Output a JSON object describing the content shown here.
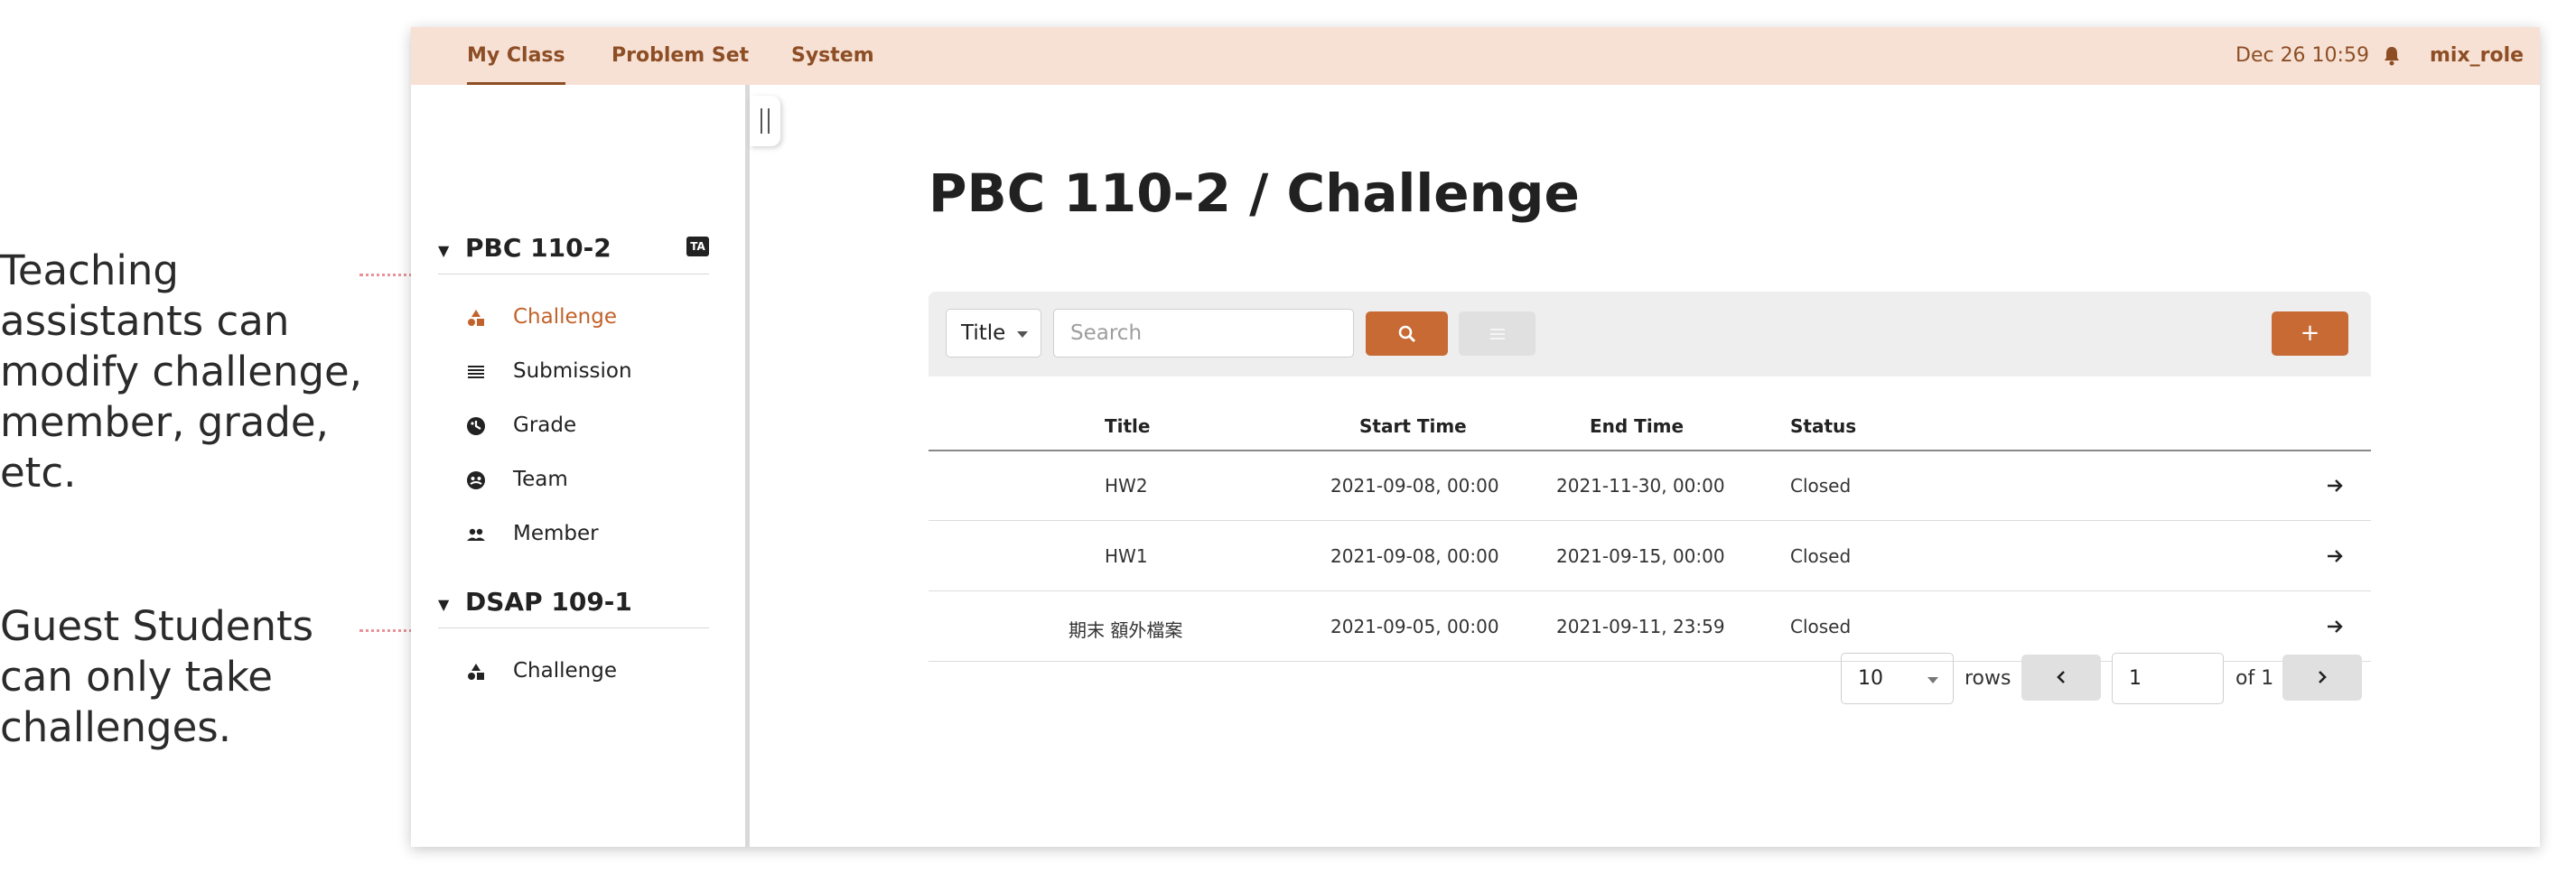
{
  "annotations": [
    {
      "lines": [
        "Teaching",
        "assistants can",
        "modify challenge,",
        "member, grade,",
        "etc."
      ]
    },
    {
      "lines": [
        "Guest Students",
        "can only take",
        "challenges."
      ]
    }
  ],
  "topbar": {
    "nav": [
      {
        "label": "My Class",
        "active": true
      },
      {
        "label": "Problem Set"
      },
      {
        "label": "System"
      }
    ],
    "datetime": "Dec 26 10:59",
    "username": "mix_role",
    "bell_icon": "bell-icon"
  },
  "sidebar": {
    "courses": [
      {
        "name": "PBC 110-2",
        "badge": "TA",
        "items": [
          {
            "label": "Challenge",
            "icon": "shapes-icon",
            "active": true
          },
          {
            "label": "Submission",
            "icon": "list-icon"
          },
          {
            "label": "Grade",
            "icon": "grade-icon"
          },
          {
            "label": "Team",
            "icon": "team-icon"
          },
          {
            "label": "Member",
            "icon": "people-icon"
          }
        ]
      },
      {
        "name": "DSAP 109-1",
        "items": [
          {
            "label": "Challenge",
            "icon": "shapes-icon"
          }
        ]
      }
    ]
  },
  "main": {
    "title": "PBC 110-2 / Challenge",
    "filter": {
      "field": "Title",
      "search_placeholder": "Search",
      "add_label": "+"
    },
    "table": {
      "columns": [
        "Title",
        "Start Time",
        "End Time",
        "Status"
      ],
      "rows": [
        {
          "title": "HW2",
          "start": "2021-09-08, 00:00",
          "end": "2021-11-30, 00:00",
          "status": "Closed"
        },
        {
          "title": "HW1",
          "start": "2021-09-08, 00:00",
          "end": "2021-09-15, 00:00",
          "status": "Closed"
        },
        {
          "title": "期末 額外檔案",
          "start": "2021-09-05, 00:00",
          "end": "2021-09-11, 23:59",
          "status": "Closed"
        }
      ]
    },
    "pagination": {
      "rows_per_page": "10",
      "rows_label": "rows",
      "page": "1",
      "of_label": "of 1"
    }
  },
  "colors": {
    "accent": "#c76a33",
    "topbar_bg": "#f7e1d4",
    "nav_text": "#8d4e25",
    "annotation_dot": "#f09aa3"
  }
}
